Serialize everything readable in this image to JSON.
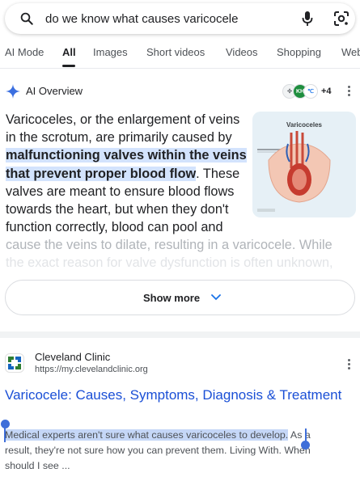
{
  "search": {
    "query": "do we know what causes varicocele"
  },
  "tabs": [
    {
      "label": "AI Mode"
    },
    {
      "label": "All"
    },
    {
      "label": "Images"
    },
    {
      "label": "Short videos"
    },
    {
      "label": "Videos"
    },
    {
      "label": "Shopping"
    },
    {
      "label": "Web"
    }
  ],
  "ai_overview": {
    "title": "AI Overview",
    "sources_more": "+4",
    "source_badge": "KH",
    "text_intro": "Varicoceles, or the enlargement of veins in the scrotum, are primarily caused by ",
    "text_highlight": "malfunctioning valves within the veins that prevent proper blood flow",
    "text_rest": ". These valves are meant to ensure blood flows towards the heart, but when they don't function correctly, blood can pool and",
    "fade_line_1": "cause the veins to dilate, resulting in a varicocele. While",
    "fade_line_2": "the exact reason for valve dysfunction is often unknown,",
    "image_title": "Varicoceles",
    "show_more": "Show more"
  },
  "result": {
    "site_name": "Cleveland Clinic",
    "url": "https://my.clevelandclinic.org",
    "title": "Varicocele: Causes, Symptoms, Diagnosis & Treatment",
    "snippet_selected": "Medical experts aren't sure what causes varicoceles to develop.",
    "snippet_rest": " As a result, they're not sure how you can prevent them. Living With. When should I see ..."
  },
  "colors": {
    "link": "#1a4fd6",
    "highlight": "#d3e3fd",
    "selection": "#c5d7f7",
    "accent": "#3f6fd9"
  }
}
